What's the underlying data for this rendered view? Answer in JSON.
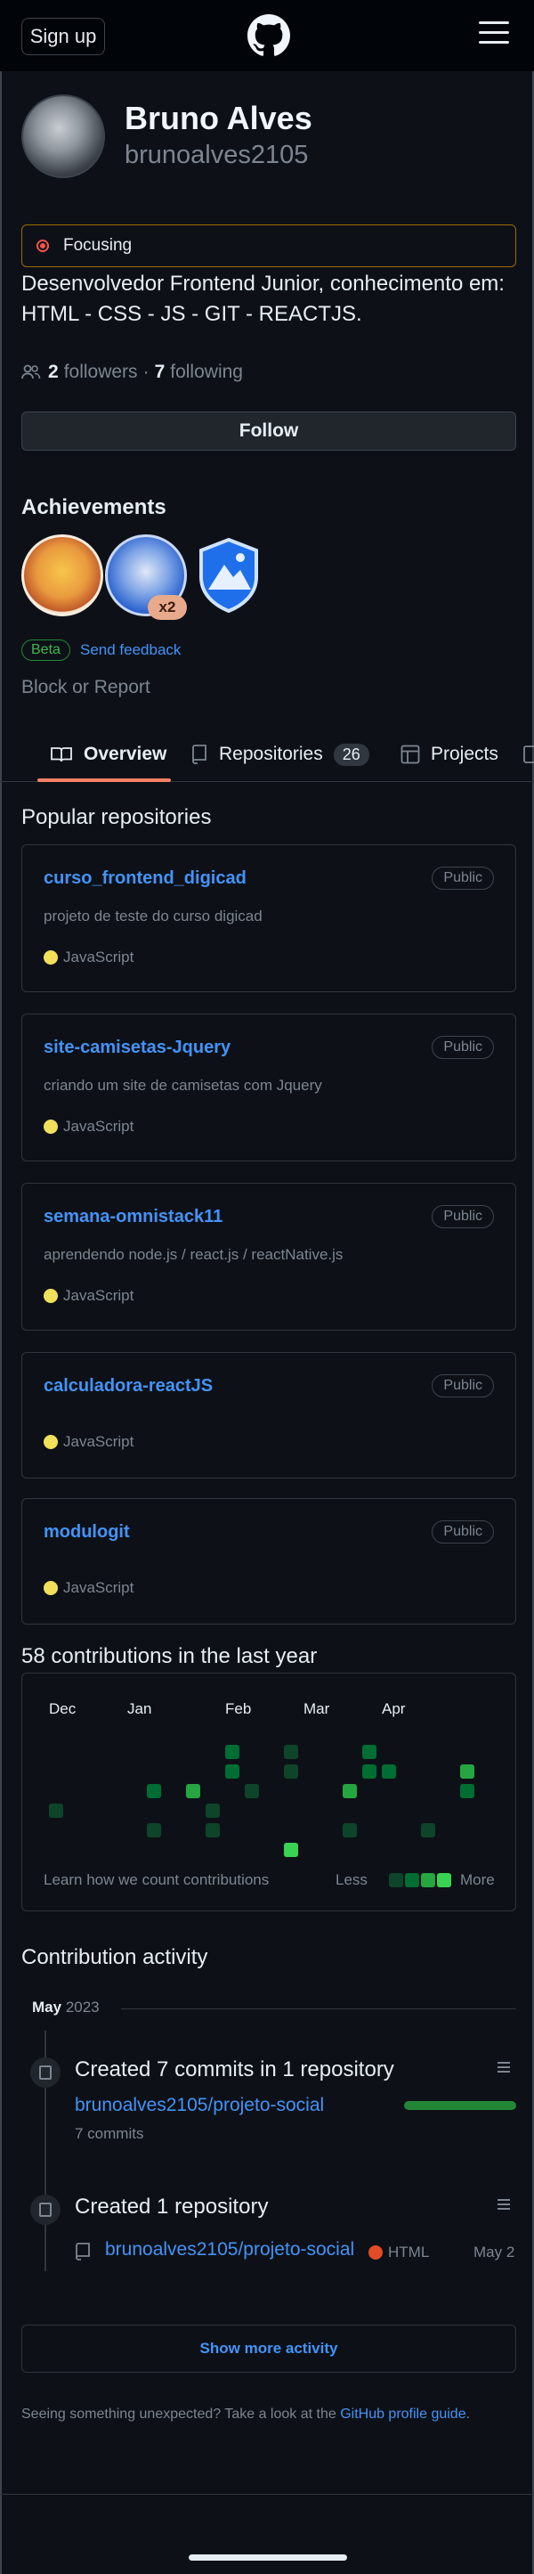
{
  "header": {
    "signup_label": "Sign up",
    "logo_icon": "github-mark-icon",
    "menu_icon": "hamburger-icon"
  },
  "profile": {
    "name": "Bruno Alves",
    "login": "brunoalves2105",
    "status": "Focusing",
    "bio": "Desenvolvedor Frontend Junior, conhecimento em: HTML - CSS - JS - GIT - REACTJS.",
    "followers_count": "2",
    "followers_label": "followers",
    "separator": "·",
    "following_count": "7",
    "following_label": "following",
    "follow_button": "Follow"
  },
  "achievements": {
    "title": "Achievements",
    "badge_multiplier": "x2",
    "beta_label": "Beta",
    "feedback_link": "Send feedback"
  },
  "block_report": "Block or Report",
  "tabs": [
    {
      "label": "Overview",
      "icon": "book-icon"
    },
    {
      "label": "Repositories",
      "icon": "repo-icon",
      "count": "26"
    },
    {
      "label": "Projects",
      "icon": "table-icon"
    }
  ],
  "popular": {
    "title": "Popular repositories",
    "repos": [
      {
        "name": "curso_frontend_digicad",
        "visibility": "Public",
        "description": "projeto de teste do curso digicad",
        "language": "JavaScript"
      },
      {
        "name": "site-camisetas-Jquery",
        "visibility": "Public",
        "description": "criando um site de camisetas com Jquery",
        "language": "JavaScript"
      },
      {
        "name": "semana-omnistack11",
        "visibility": "Public",
        "description": "aprendendo node.js / react.js / reactNative.js",
        "language": "JavaScript"
      },
      {
        "name": "calculadora-reactJS",
        "visibility": "Public",
        "description": "",
        "language": "JavaScript"
      },
      {
        "name": "modulogit",
        "visibility": "Public",
        "description": "",
        "language": "JavaScript"
      }
    ],
    "language_color": "#f1e05a"
  },
  "contributions": {
    "title": "58 contributions in the last year",
    "months": [
      "Dec",
      "Jan",
      "Feb",
      "Mar",
      "Apr"
    ],
    "learn_link": "Learn how we count contributions",
    "less_label": "Less",
    "more_label": "More",
    "level_colors": [
      "#0e4429",
      "#006d32",
      "#26a641",
      "#39d353"
    ]
  },
  "activity": {
    "title": "Contribution activity",
    "month": "May",
    "year": "2023",
    "items": [
      {
        "title": "Created 7 commits in 1 repository",
        "repo": "brunoalves2105/projeto-social",
        "detail": "7 commits"
      },
      {
        "title": "Created 1 repository",
        "repo": "brunoalves2105/projeto-social",
        "language": "HTML",
        "date": "May 2"
      }
    ],
    "show_more": "Show more activity"
  },
  "footer_note": {
    "text": "Seeing something unexpected? Take a look at the",
    "link": "GitHub profile guide",
    "end": "."
  }
}
